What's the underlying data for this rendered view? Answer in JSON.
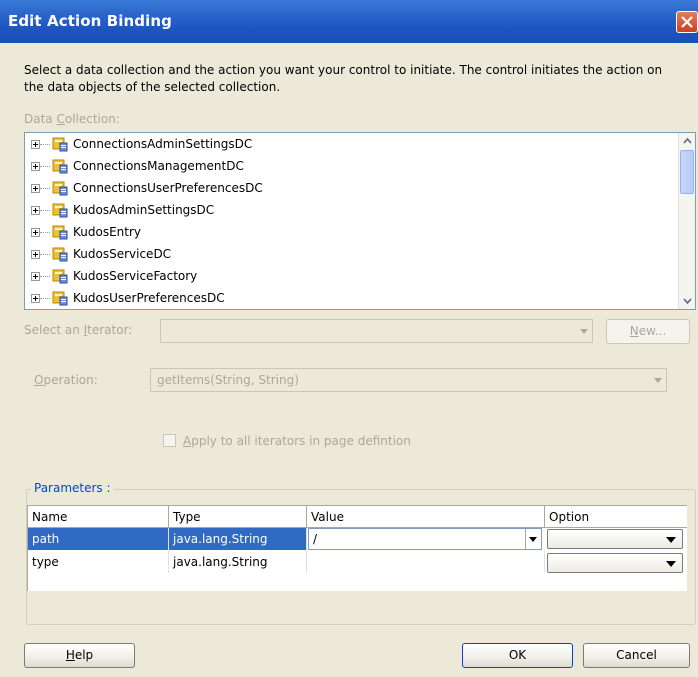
{
  "window": {
    "title": "Edit Action Binding",
    "instructions": "Select a data collection and the action you want your control to initiate. The control initiates the action on the data objects of the selected collection."
  },
  "data_collection": {
    "label_pre": "Data ",
    "label_u": "C",
    "label_post": "ollection:",
    "items": [
      {
        "label": "ConnectionsAdminSettingsDC"
      },
      {
        "label": "ConnectionsManagementDC"
      },
      {
        "label": "ConnectionsUserPreferencesDC"
      },
      {
        "label": "KudosAdminSettingsDC"
      },
      {
        "label": "KudosEntry"
      },
      {
        "label": "KudosServiceDC"
      },
      {
        "label": "KudosServiceFactory"
      },
      {
        "label": "KudosUserPreferencesDC"
      }
    ]
  },
  "iterator": {
    "label_pre": "Select an ",
    "label_u": "I",
    "label_post": "terator:",
    "value": "",
    "new_pre": "",
    "new_u": "N",
    "new_post": "ew..."
  },
  "operation": {
    "label_u": "O",
    "label_post": "peration:",
    "value": "getItems(String, String)"
  },
  "apply_all": {
    "label_u": "A",
    "label_post": "pply to all iterators in page defintion",
    "checked": false
  },
  "parameters": {
    "title": "Parameters :",
    "columns": [
      "Name",
      "Type",
      "Value",
      "Option"
    ],
    "rows": [
      {
        "name": "path",
        "type": "java.lang.String",
        "value": "/",
        "option": ""
      },
      {
        "name": "type",
        "type": "java.lang.String",
        "value": "",
        "option": ""
      }
    ]
  },
  "buttons": {
    "help_u": "H",
    "help_post": "elp",
    "ok": "OK",
    "cancel": "Cancel"
  },
  "colors": {
    "title_bar": "#2a64c9",
    "selection": "#316ac5",
    "group_title": "#0046d5",
    "disabled_text": "#aca899"
  }
}
